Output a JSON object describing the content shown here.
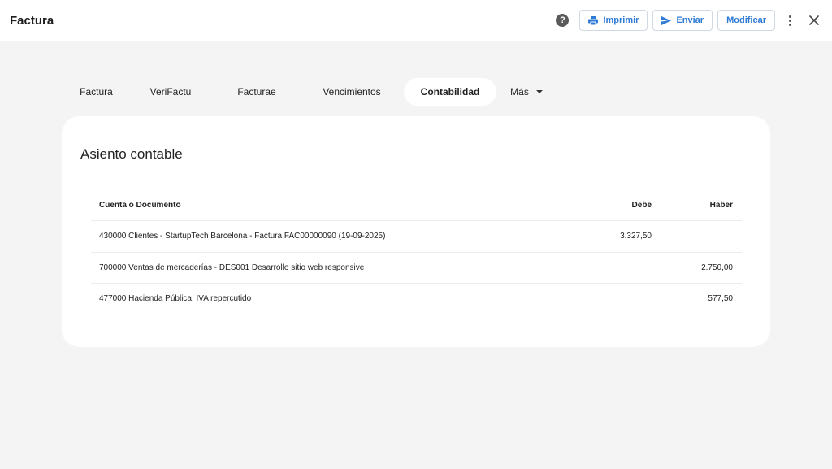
{
  "header": {
    "title": "Factura",
    "actions": {
      "print_label": "Imprimir",
      "send_label": "Enviar",
      "edit_label": "Modificar"
    },
    "icons": [
      "help-icon",
      "printer-icon",
      "send-icon",
      "more-vertical-icon",
      "close-icon"
    ]
  },
  "tabs": [
    {
      "label": "Factura",
      "active": false
    },
    {
      "label": "VeriFactu",
      "active": false
    },
    {
      "label": "Facturae",
      "active": false
    },
    {
      "label": "Vencimientos",
      "active": false
    },
    {
      "label": "Contabilidad",
      "active": true
    },
    {
      "label": "Más",
      "active": false
    }
  ],
  "card": {
    "title": "Asiento contable",
    "columns": {
      "doc": "Cuenta o Documento",
      "debe": "Debe",
      "haber": "Haber"
    },
    "rows": [
      {
        "doc": "430000 Clientes - StartupTech Barcelona - Factura FAC00000090 (19-09-2025)",
        "debe": "3.327,50",
        "haber": ""
      },
      {
        "doc": "700000 Ventas de mercaderías - DES001 Desarrollo sitio web responsive",
        "debe": "",
        "haber": "2.750,00"
      },
      {
        "doc": "477000 Hacienda Pública. IVA repercutido",
        "debe": "",
        "haber": "577,50"
      }
    ]
  },
  "colors": {
    "accent": "#2e7bd6",
    "background": "#f4f4f5",
    "surface": "#ffffff"
  }
}
